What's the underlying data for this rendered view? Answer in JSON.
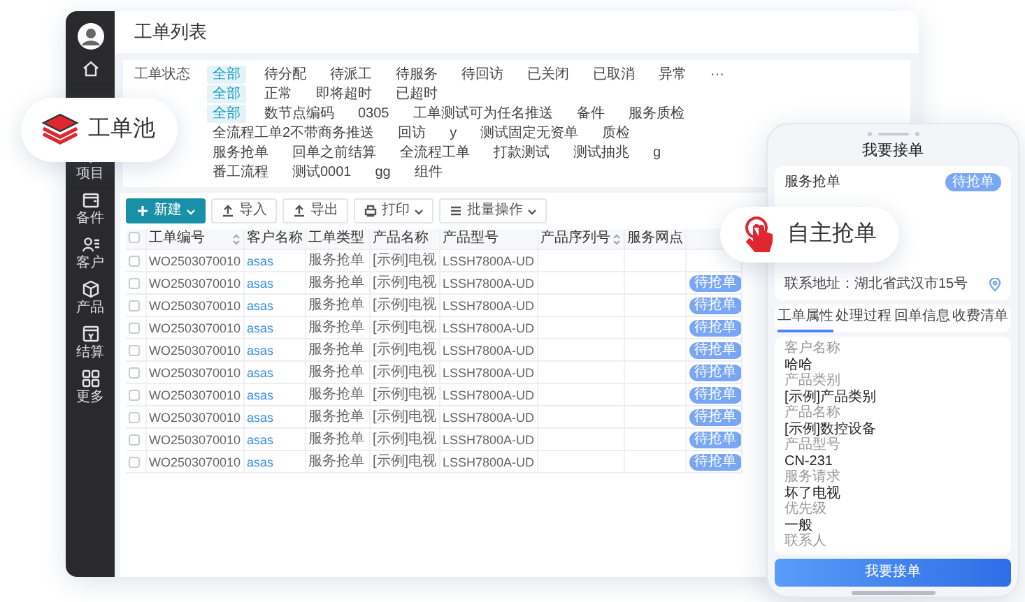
{
  "sidebar": {
    "items": [
      {
        "kind": "home"
      },
      {
        "kind": "project",
        "label": "项目"
      },
      {
        "kind": "parts",
        "label": "备件"
      },
      {
        "kind": "customer",
        "label": "客户"
      },
      {
        "kind": "product",
        "label": "产品"
      },
      {
        "kind": "settlement",
        "label": "结算"
      },
      {
        "kind": "more",
        "label": "更多"
      }
    ]
  },
  "window": {
    "title": "工单列表"
  },
  "filters": [
    {
      "label": "工单状态",
      "options": [
        {
          "text": "全部",
          "selected": true
        },
        {
          "text": "待分配",
          "selected": false
        },
        {
          "text": "待派工",
          "selected": false
        },
        {
          "text": "待服务",
          "selected": false
        },
        {
          "text": "待回访",
          "selected": false
        },
        {
          "text": "已关闭",
          "selected": false
        },
        {
          "text": "已取消",
          "selected": false
        },
        {
          "text": "异常",
          "selected": false
        },
        {
          "text": "···",
          "selected": false
        }
      ]
    },
    {
      "options": [
        {
          "text": "全部",
          "selected": true
        },
        {
          "text": "正常",
          "selected": false
        },
        {
          "text": "即将超时",
          "selected": false
        },
        {
          "text": "已超时",
          "selected": false
        }
      ]
    },
    {
      "options": [
        {
          "text": "全部",
          "selected": true
        },
        {
          "text": "数节点编码",
          "selected": false
        },
        {
          "text": "0305",
          "selected": false
        },
        {
          "text": "工单测试可为任名推送",
          "selected": false
        },
        {
          "text": "备件",
          "selected": false
        },
        {
          "text": "服务质检",
          "selected": false
        },
        {
          "text": "全流程工单2不带商务推送",
          "selected": false
        },
        {
          "text": "回访",
          "selected": false
        },
        {
          "text": "y",
          "selected": false
        },
        {
          "text": "测试固定无资单",
          "selected": false
        },
        {
          "text": "质检",
          "selected": false
        }
      ]
    },
    {
      "options": [
        {
          "text": "服务抢单",
          "selected": false
        },
        {
          "text": "回单之前结算",
          "selected": false
        },
        {
          "text": "全流程工单",
          "selected": false
        },
        {
          "text": "打款测试",
          "selected": false
        },
        {
          "text": "测试抽兆",
          "selected": false
        },
        {
          "text": "g",
          "selected": false
        },
        {
          "text": "番工流程",
          "selected": false
        },
        {
          "text": "测试0001",
          "selected": false
        },
        {
          "text": "gg",
          "selected": false
        },
        {
          "text": "组件",
          "selected": false
        }
      ]
    }
  ],
  "toolbar": [
    {
      "label": "新建",
      "kind": "create",
      "dropdown": true
    },
    {
      "label": "导入",
      "kind": "import",
      "dropdown": false
    },
    {
      "label": "导出",
      "kind": "export",
      "dropdown": false
    },
    {
      "label": "打印",
      "kind": "print",
      "dropdown": true
    },
    {
      "label": "批量操作",
      "kind": "batch",
      "dropdown": true
    }
  ],
  "table": {
    "all_checked": false,
    "columns": [
      {
        "label": "工单编号",
        "sortable": true
      },
      {
        "label": "客户名称",
        "sortable": false
      },
      {
        "label": "工单类型",
        "sortable": false
      },
      {
        "label": "产品名称",
        "sortable": false
      },
      {
        "label": "产品型号",
        "sortable": false
      },
      {
        "label": "产品序列号",
        "sortable": true
      },
      {
        "label": "服务网点",
        "sortable": false
      }
    ],
    "rows": [
      {
        "checked": false,
        "cells": [
          "WO2503070010",
          "asas",
          "服务抢单",
          "[示例]电视",
          "LSSH7800A-UD"
        ]
      },
      {
        "checked": false,
        "cells": [
          "WO2503070010",
          "asas",
          "服务抢单",
          "[示例]电视",
          "LSSH7800A-UD"
        ],
        "status": "待抢单"
      },
      {
        "checked": false,
        "cells": [
          "WO2503070010",
          "asas",
          "服务抢单",
          "[示例]电视",
          "LSSH7800A-UD"
        ],
        "status": "待抢单"
      },
      {
        "checked": false,
        "cells": [
          "WO2503070010",
          "asas",
          "服务抢单",
          "[示例]电视",
          "LSSH7800A-UD"
        ],
        "status": "待抢单"
      },
      {
        "checked": false,
        "cells": [
          "WO2503070010",
          "asas",
          "服务抢单",
          "[示例]电视",
          "LSSH7800A-UD"
        ],
        "status": "待抢单"
      },
      {
        "checked": false,
        "cells": [
          "WO2503070010",
          "asas",
          "服务抢单",
          "[示例]电视",
          "LSSH7800A-UD"
        ],
        "status": "待抢单"
      },
      {
        "checked": false,
        "cells": [
          "WO2503070010",
          "asas",
          "服务抢单",
          "[示例]电视",
          "LSSH7800A-UD"
        ],
        "status": "待抢单"
      },
      {
        "checked": false,
        "cells": [
          "WO2503070010",
          "asas",
          "服务抢单",
          "[示例]电视",
          "LSSH7800A-UD"
        ],
        "status": "待抢单"
      },
      {
        "checked": false,
        "cells": [
          "WO2503070010",
          "asas",
          "服务抢单",
          "[示例]电视",
          "LSSH7800A-UD"
        ],
        "status": "待抢单"
      },
      {
        "checked": false,
        "cells": [
          "WO2503070010",
          "asas",
          "服务抢单",
          "[示例]电视",
          "LSSH7800A-UD"
        ],
        "status": "待抢单"
      }
    ]
  },
  "phone": {
    "title": "我要接单",
    "card": {
      "title": "服务抢单",
      "badge": "待抢单",
      "address": "联系地址：湖北省武汉市15号"
    },
    "tabs": [
      {
        "label": "工单属性",
        "selected": true
      },
      {
        "label": "处理过程",
        "selected": false
      },
      {
        "label": "回单信息",
        "selected": false
      },
      {
        "label": "收费清单",
        "selected": false
      }
    ],
    "fields": [
      {
        "label": "客户名称",
        "value": "哈哈"
      },
      {
        "label": "产品类别",
        "value": "[示例]产品类别"
      },
      {
        "label": "产品名称",
        "value": "[示例]数控设备"
      },
      {
        "label": "产品型号",
        "value": "CN-231"
      },
      {
        "label": "服务请求",
        "value": "坏了电视"
      },
      {
        "label": "优先级",
        "value": "一般"
      },
      {
        "label": "联系人"
      }
    ],
    "button": "我要接单"
  },
  "callouts": [
    {
      "kind": "layers",
      "text": "工单池"
    },
    {
      "kind": "hand",
      "text": "自主抢单"
    }
  ]
}
